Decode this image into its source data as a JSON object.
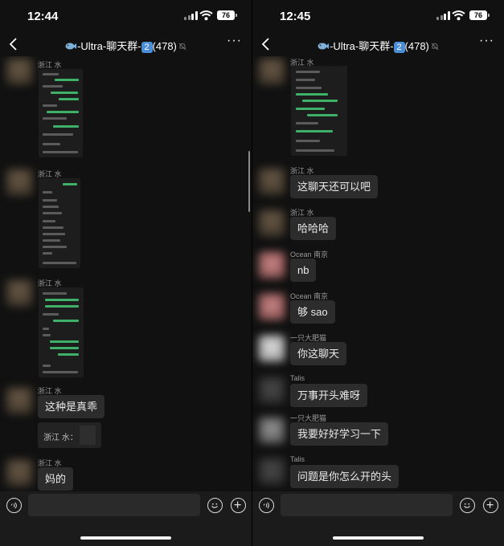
{
  "left": {
    "time": "12:44",
    "battery": "76",
    "chat_title_prefix": "-Ultra-聊天群-",
    "chat_title_badge": "2",
    "chat_title_count": "(478)",
    "messages": [
      {
        "sender": "浙江 水",
        "type": "image"
      },
      {
        "sender": "浙江 水",
        "type": "image"
      },
      {
        "sender": "浙江 水",
        "type": "image"
      },
      {
        "sender": "浙江 水",
        "text": "这种是真乖",
        "quote": "浙江 水："
      },
      {
        "sender": "浙江 水",
        "text": "妈的"
      }
    ]
  },
  "right": {
    "time": "12:45",
    "battery": "76",
    "chat_title_prefix": "-Ultra-聊天群-",
    "chat_title_badge": "2",
    "chat_title_count": "(478)",
    "messages": [
      {
        "sender": "浙江 水",
        "type": "image"
      },
      {
        "sender": "浙江 水",
        "text": "这聊天还可以吧"
      },
      {
        "sender": "浙江 水",
        "text": "哈哈哈"
      },
      {
        "sender": "Ocean 南京",
        "text": "nb"
      },
      {
        "sender": "Ocean 南京",
        "text": "够 sao"
      },
      {
        "sender": "一只大肥猫",
        "text": "你这聊天"
      },
      {
        "sender": "Talis",
        "text": "万事开头难呀"
      },
      {
        "sender": "一只大肥猫",
        "text": "我要好好学习一下"
      },
      {
        "sender": "Talis",
        "text": "问题是你怎么开的头"
      }
    ]
  },
  "icons": {
    "back": "chevron-left-icon",
    "more": "ellipsis-icon",
    "voice": "voice-icon",
    "emoji": "smile-icon",
    "plus": "plus-icon",
    "mute": "bell-off-icon"
  },
  "colors": {
    "background": "#111111",
    "bubble": "#2c2c2c",
    "wechat_green": "#3fb068",
    "badge_blue": "#4a8ed8"
  }
}
